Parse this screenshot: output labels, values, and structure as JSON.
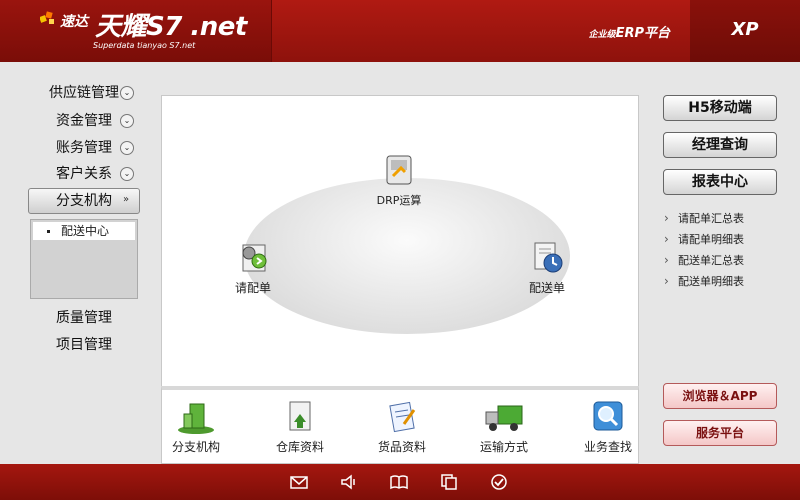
{
  "header": {
    "logo_cn": "速达",
    "logo_title": "天耀S7 .net",
    "logo_sub": "Superdata tianyao S7.net",
    "erp_small": "企业级",
    "erp_label": "ERP平台",
    "xp_label": "XP"
  },
  "sidebar": {
    "items": [
      {
        "label": "供应链管理"
      },
      {
        "label": "资金管理"
      },
      {
        "label": "账务管理"
      },
      {
        "label": "客户关系"
      },
      {
        "label": "分支机构"
      },
      {
        "label": "质量管理"
      },
      {
        "label": "项目管理"
      }
    ],
    "submenu": [
      {
        "label": "配送中心"
      }
    ]
  },
  "main": {
    "nodes": [
      {
        "label": "DRP运算",
        "icon": "drp-calc-icon"
      },
      {
        "label": "请配单",
        "icon": "request-gear-icon"
      },
      {
        "label": "配送单",
        "icon": "delivery-clock-icon"
      }
    ],
    "bottom": [
      {
        "label": "分支机构",
        "icon": "building-icon"
      },
      {
        "label": "仓库资料",
        "icon": "warehouse-doc-icon"
      },
      {
        "label": "货品资料",
        "icon": "goods-doc-icon"
      },
      {
        "label": "运输方式",
        "icon": "truck-icon"
      },
      {
        "label": "业务查找",
        "icon": "search-icon"
      }
    ]
  },
  "right": {
    "buttons": [
      {
        "label": "H5移动端"
      },
      {
        "label": "经理查询"
      },
      {
        "label": "报表中心"
      }
    ],
    "reports": [
      {
        "label": "请配单汇总表"
      },
      {
        "label": "请配单明细表"
      },
      {
        "label": "配送单汇总表"
      },
      {
        "label": "配送单明细表"
      }
    ],
    "bottom_buttons": [
      {
        "label": "浏览器＆APP"
      },
      {
        "label": "服务平台"
      }
    ]
  },
  "footer": {
    "icons": [
      "mail-icon",
      "speaker-icon",
      "book-icon",
      "copy-icon",
      "check-icon"
    ]
  },
  "colors": {
    "brand": "#9e150e",
    "accent_pink": "#f4c7c7"
  }
}
